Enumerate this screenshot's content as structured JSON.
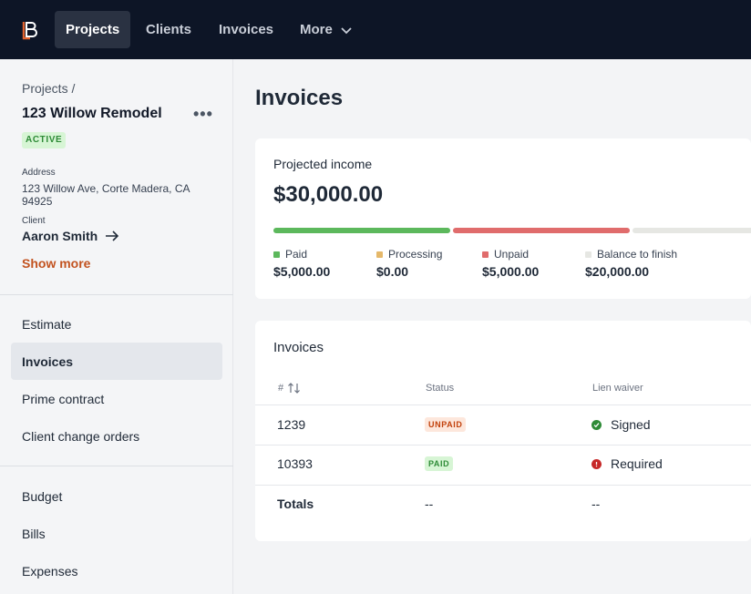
{
  "nav": {
    "items": [
      {
        "label": "Projects",
        "active": true
      },
      {
        "label": "Clients",
        "active": false
      },
      {
        "label": "Invoices",
        "active": false
      },
      {
        "label": "More",
        "active": false
      }
    ],
    "brand_color": "#e2632f"
  },
  "sidebar": {
    "breadcrumb": "Projects /",
    "project_name": "123 Willow Remodel",
    "status_badge": "ACTIVE",
    "address_label": "Address",
    "address": "123 Willow Ave, Corte Madera, CA 94925",
    "client_label": "Client",
    "client_name": "Aaron Smith",
    "show_more": "Show more",
    "links_group1": [
      {
        "label": "Estimate",
        "active": false
      },
      {
        "label": "Invoices",
        "active": true
      },
      {
        "label": "Prime contract",
        "active": false
      },
      {
        "label": "Client change orders",
        "active": false
      }
    ],
    "links_group2": [
      {
        "label": "Budget",
        "active": false
      },
      {
        "label": "Bills",
        "active": false
      },
      {
        "label": "Expenses",
        "active": false
      }
    ]
  },
  "main": {
    "title": "Invoices",
    "projected": {
      "label": "Projected income",
      "amount": "$30,000.00",
      "segments": [
        {
          "name": "Paid",
          "value": "$5,000.00",
          "color": "#5cb85c"
        },
        {
          "name": "Processing",
          "value": "$0.00",
          "color": "#e5b86a"
        },
        {
          "name": "Unpaid",
          "value": "$5,000.00",
          "color": "#e06c6c"
        },
        {
          "name": "Balance to finish",
          "value": "$20,000.00",
          "color": "#e6e7e3"
        }
      ]
    },
    "invoices": {
      "title": "Invoices",
      "columns": [
        "#",
        "Status",
        "Lien waiver"
      ],
      "rows": [
        {
          "number": "1239",
          "status": "UNPAID",
          "status_type": "unpaid",
          "lien": "Signed",
          "lien_type": "signed"
        },
        {
          "number": "10393",
          "status": "PAID",
          "status_type": "paid",
          "lien": "Required",
          "lien_type": "required"
        }
      ],
      "totals": {
        "label": "Totals",
        "status": "--",
        "lien": "--"
      }
    }
  }
}
